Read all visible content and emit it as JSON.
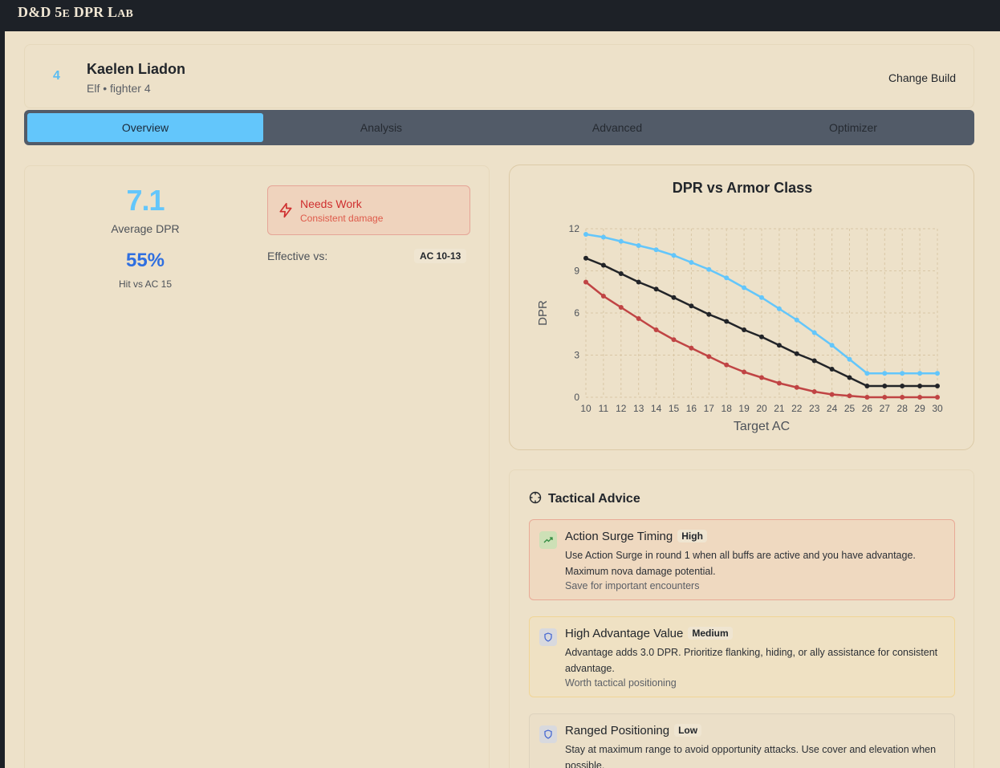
{
  "app": {
    "brand_main": "D&D 5",
    "brand_e": "E",
    "brand_mid": " DPR L",
    "brand_end": "AB"
  },
  "character": {
    "level": "4",
    "name": "Kaelen Liadon",
    "subtitle": "Elf • fighter 4",
    "change_build_label": "Change Build"
  },
  "tabs": [
    {
      "label": "Overview",
      "active": true
    },
    {
      "label": "Analysis",
      "active": false
    },
    {
      "label": "Advanced",
      "active": false
    },
    {
      "label": "Optimizer",
      "active": false
    }
  ],
  "overview": {
    "avg_dpr_value": "7.1",
    "avg_dpr_label": "Average DPR",
    "hit_value": "55%",
    "hit_label": "Hit vs AC 15",
    "status_title": "Needs Work",
    "status_subtitle": "Consistent damage",
    "effective_label": "Effective vs:",
    "effective_value": "AC 10-13"
  },
  "chart_data": {
    "type": "line",
    "title": "DPR vs Armor Class",
    "xlabel": "Target AC",
    "ylabel": "DPR",
    "x": [
      10,
      11,
      12,
      13,
      14,
      15,
      16,
      17,
      18,
      19,
      20,
      21,
      22,
      23,
      24,
      25,
      26,
      27,
      28,
      29,
      30
    ],
    "xlim": [
      10,
      30
    ],
    "ylim": [
      0,
      12
    ],
    "yticks": [
      0,
      3,
      6,
      9,
      12
    ],
    "grid": true,
    "series": [
      {
        "color": "#63c6fb",
        "values": [
          11.6,
          11.4,
          11.1,
          10.8,
          10.5,
          10.1,
          9.6,
          9.1,
          8.5,
          7.8,
          7.1,
          6.3,
          5.5,
          4.6,
          3.7,
          2.7,
          1.7,
          1.7,
          1.7,
          1.7,
          1.7
        ]
      },
      {
        "color": "#222428",
        "values": [
          9.9,
          9.4,
          8.8,
          8.2,
          7.7,
          7.1,
          6.5,
          5.9,
          5.4,
          4.8,
          4.3,
          3.7,
          3.1,
          2.6,
          2.0,
          1.4,
          0.8,
          0.8,
          0.8,
          0.8,
          0.8
        ]
      },
      {
        "color": "#c04444",
        "values": [
          8.2,
          7.2,
          6.4,
          5.6,
          4.8,
          4.1,
          3.5,
          2.9,
          2.3,
          1.8,
          1.4,
          1.0,
          0.7,
          0.4,
          0.2,
          0.1,
          0.0,
          0.0,
          0.0,
          0.0,
          0.0
        ]
      }
    ]
  },
  "advice": {
    "title": "Tactical Advice",
    "items": [
      {
        "title": "Action Surge Timing",
        "priority": "High",
        "description": "Use Action Surge in round 1 when all buffs are active and you have advantage. Maximum nova damage potential.",
        "note": "Save for important encounters"
      },
      {
        "title": "High Advantage Value",
        "priority": "Medium",
        "description": "Advantage adds 3.0 DPR. Prioritize flanking, hiding, or ally assistance for consistent advantage.",
        "note": "Worth tactical positioning"
      },
      {
        "title": "Ranged Positioning",
        "priority": "Low",
        "description": "Stay at maximum range to avoid opportunity attacks. Use cover and elevation when possible.",
        "note": ""
      }
    ]
  }
}
